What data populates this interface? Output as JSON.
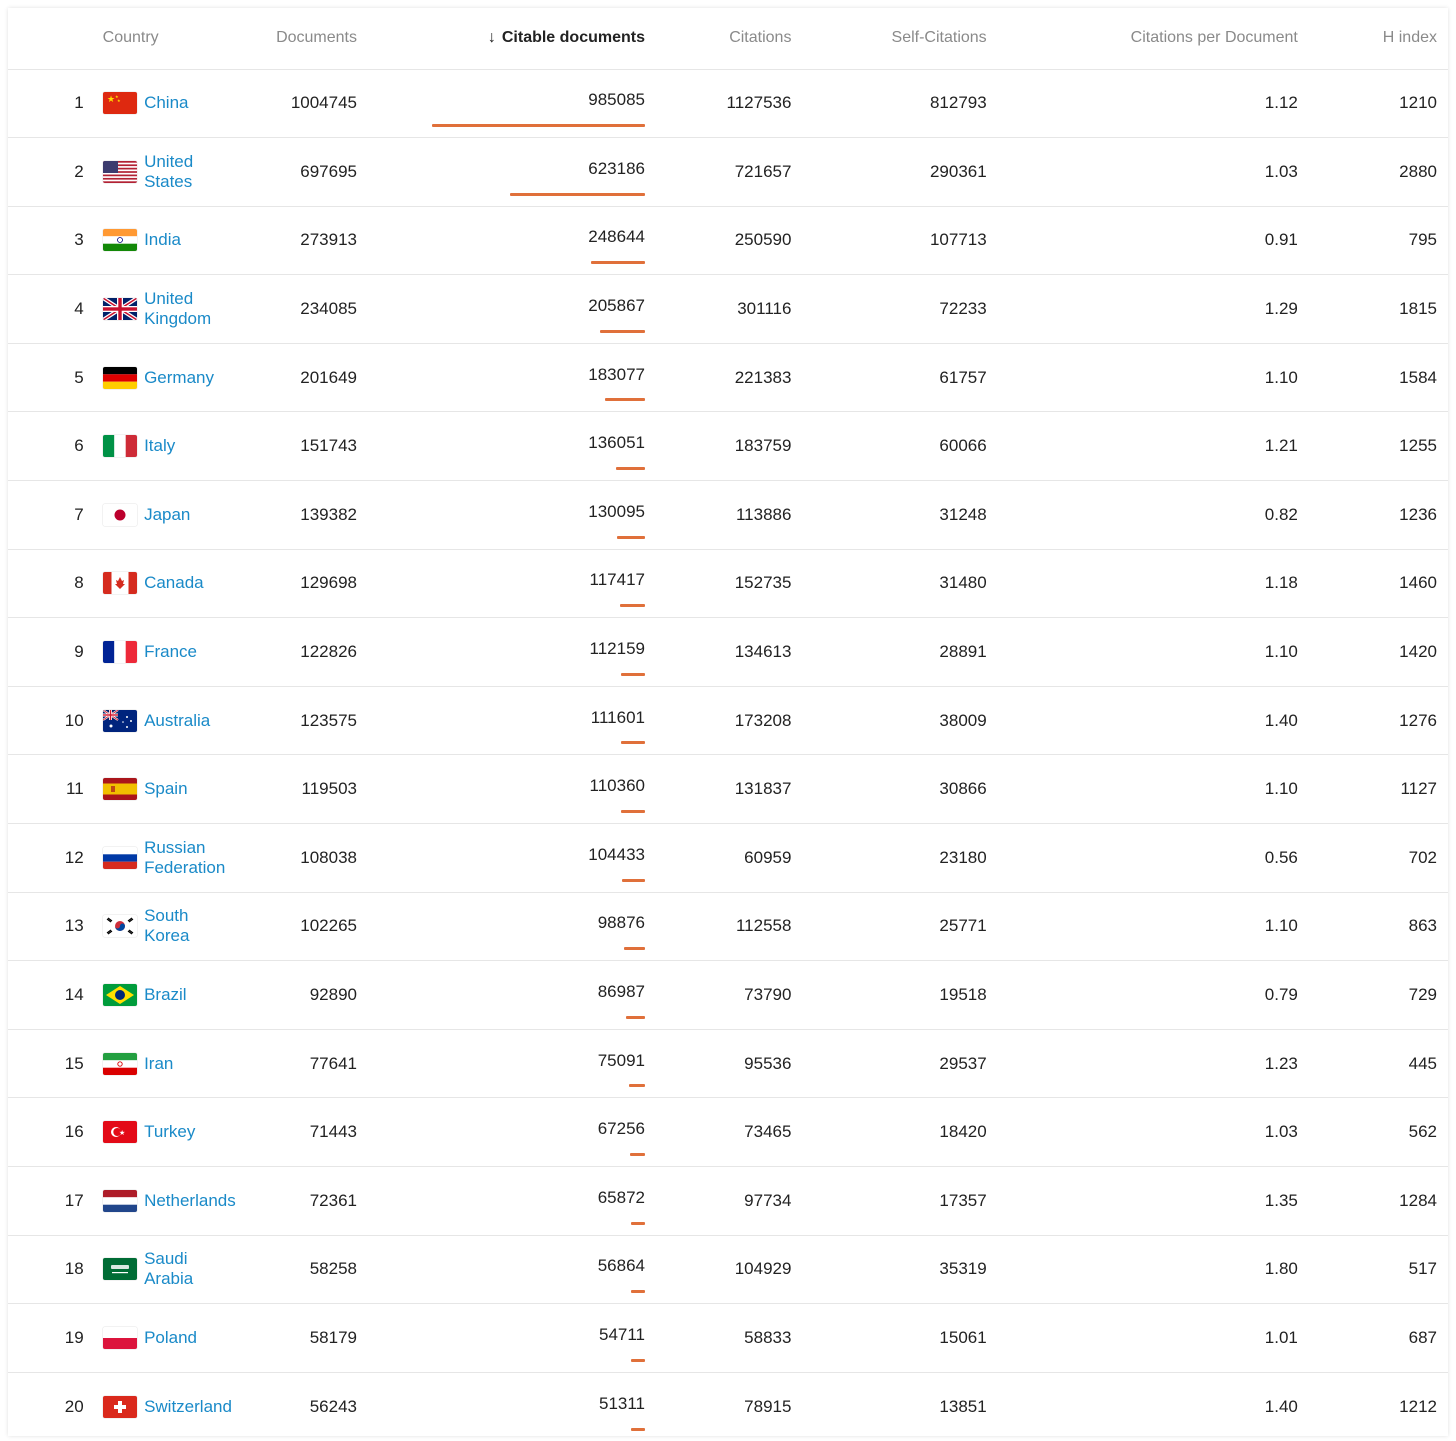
{
  "header": {
    "country": "Country",
    "documents": "Documents",
    "citable_documents": "Citable documents",
    "citations": "Citations",
    "self_citations": "Self-Citations",
    "citations_per_document": "Citations per Document",
    "h_index": "H index",
    "sort_icon": "arrow-down-icon"
  },
  "colors": {
    "link": "#1a8ac8",
    "bar": "#e0703a"
  },
  "rows": [
    {
      "rank": "1",
      "country": "China",
      "flag": "china",
      "documents": "1004745",
      "citable": "985085",
      "citable_value": 985085,
      "citations": "1127536",
      "self": "812793",
      "cpd": "1.12",
      "h": "1210"
    },
    {
      "rank": "2",
      "country": "United States",
      "flag": "usa",
      "documents": "697695",
      "citable": "623186",
      "citable_value": 623186,
      "citations": "721657",
      "self": "290361",
      "cpd": "1.03",
      "h": "2880"
    },
    {
      "rank": "3",
      "country": "India",
      "flag": "india",
      "documents": "273913",
      "citable": "248644",
      "citable_value": 248644,
      "citations": "250590",
      "self": "107713",
      "cpd": "0.91",
      "h": "795"
    },
    {
      "rank": "4",
      "country": "United Kingdom",
      "flag": "uk",
      "documents": "234085",
      "citable": "205867",
      "citable_value": 205867,
      "citations": "301116",
      "self": "72233",
      "cpd": "1.29",
      "h": "1815"
    },
    {
      "rank": "5",
      "country": "Germany",
      "flag": "germany",
      "documents": "201649",
      "citable": "183077",
      "citable_value": 183077,
      "citations": "221383",
      "self": "61757",
      "cpd": "1.10",
      "h": "1584"
    },
    {
      "rank": "6",
      "country": "Italy",
      "flag": "italy",
      "documents": "151743",
      "citable": "136051",
      "citable_value": 136051,
      "citations": "183759",
      "self": "60066",
      "cpd": "1.21",
      "h": "1255"
    },
    {
      "rank": "7",
      "country": "Japan",
      "flag": "japan",
      "documents": "139382",
      "citable": "130095",
      "citable_value": 130095,
      "citations": "113886",
      "self": "31248",
      "cpd": "0.82",
      "h": "1236"
    },
    {
      "rank": "8",
      "country": "Canada",
      "flag": "canada",
      "documents": "129698",
      "citable": "117417",
      "citable_value": 117417,
      "citations": "152735",
      "self": "31480",
      "cpd": "1.18",
      "h": "1460"
    },
    {
      "rank": "9",
      "country": "France",
      "flag": "france",
      "documents": "122826",
      "citable": "112159",
      "citable_value": 112159,
      "citations": "134613",
      "self": "28891",
      "cpd": "1.10",
      "h": "1420"
    },
    {
      "rank": "10",
      "country": "Australia",
      "flag": "australia",
      "documents": "123575",
      "citable": "111601",
      "citable_value": 111601,
      "citations": "173208",
      "self": "38009",
      "cpd": "1.40",
      "h": "1276"
    },
    {
      "rank": "11",
      "country": "Spain",
      "flag": "spain",
      "documents": "119503",
      "citable": "110360",
      "citable_value": 110360,
      "citations": "131837",
      "self": "30866",
      "cpd": "1.10",
      "h": "1127"
    },
    {
      "rank": "12",
      "country": "Russian Federation",
      "flag": "russia",
      "documents": "108038",
      "citable": "104433",
      "citable_value": 104433,
      "citations": "60959",
      "self": "23180",
      "cpd": "0.56",
      "h": "702"
    },
    {
      "rank": "13",
      "country": "South Korea",
      "flag": "korea",
      "documents": "102265",
      "citable": "98876",
      "citable_value": 98876,
      "citations": "112558",
      "self": "25771",
      "cpd": "1.10",
      "h": "863"
    },
    {
      "rank": "14",
      "country": "Brazil",
      "flag": "brazil",
      "documents": "92890",
      "citable": "86987",
      "citable_value": 86987,
      "citations": "73790",
      "self": "19518",
      "cpd": "0.79",
      "h": "729"
    },
    {
      "rank": "15",
      "country": "Iran",
      "flag": "iran",
      "documents": "77641",
      "citable": "75091",
      "citable_value": 75091,
      "citations": "95536",
      "self": "29537",
      "cpd": "1.23",
      "h": "445"
    },
    {
      "rank": "16",
      "country": "Turkey",
      "flag": "turkey",
      "documents": "71443",
      "citable": "67256",
      "citable_value": 67256,
      "citations": "73465",
      "self": "18420",
      "cpd": "1.03",
      "h": "562"
    },
    {
      "rank": "17",
      "country": "Netherlands",
      "flag": "netherlands",
      "documents": "72361",
      "citable": "65872",
      "citable_value": 65872,
      "citations": "97734",
      "self": "17357",
      "cpd": "1.35",
      "h": "1284"
    },
    {
      "rank": "18",
      "country": "Saudi Arabia",
      "flag": "saudi",
      "documents": "58258",
      "citable": "56864",
      "citable_value": 56864,
      "citations": "104929",
      "self": "35319",
      "cpd": "1.80",
      "h": "517"
    },
    {
      "rank": "19",
      "country": "Poland",
      "flag": "poland",
      "documents": "58179",
      "citable": "54711",
      "citable_value": 54711,
      "citations": "58833",
      "self": "15061",
      "cpd": "1.01",
      "h": "687"
    },
    {
      "rank": "20",
      "country": "Switzerland",
      "flag": "switzerland",
      "documents": "56243",
      "citable": "51311",
      "citable_value": 51311,
      "citations": "78915",
      "self": "13851",
      "cpd": "1.40",
      "h": "1212"
    }
  ]
}
